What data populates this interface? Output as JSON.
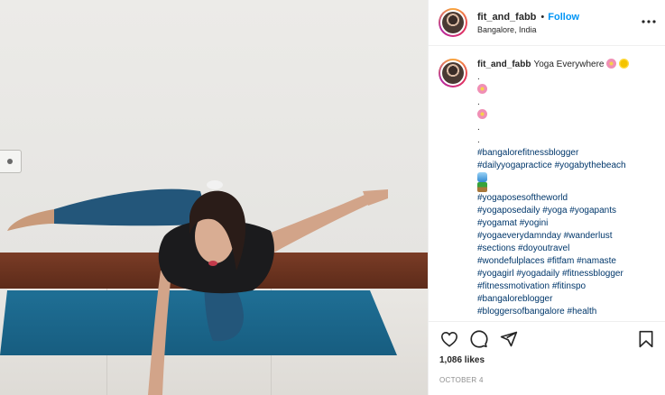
{
  "post": {
    "username": "fit_and_fabb",
    "location": "Bangalore, India",
    "follow_label": "Follow",
    "separator": "•",
    "more_icon": "more-horizontal-icon",
    "caption": {
      "username": "fit_and_fabb",
      "text": "Yoga Everywhere",
      "filler_lines": [
        "."
      ],
      "hashtag_lines": [
        "#bangalorefitnessblogger",
        "#dailyyogapractice #yogabythebeach",
        "#yogaposesoftheworld",
        "#yogaposedaily #yoga #yogapants",
        "#yogamat #yogini",
        "#yogaeverydamnday #wanderlust",
        "#sections #doyoutravel",
        "#wondefulplaces #fitfam #namaste",
        "#yogagirl #yogadaily #fitnessblogger",
        "#fitnessmotivation #fitinspo",
        "#bangaloreblogger",
        "#bloggersofbangalore #health"
      ]
    },
    "actions": {
      "like_icon": "heart-icon",
      "comment_icon": "comment-icon",
      "share_icon": "share-icon",
      "save_icon": "bookmark-icon"
    },
    "likes_text": "1,086 likes",
    "date_text": "OCTOBER 4",
    "colors": {
      "follow": "#0095f6",
      "hashtag": "#00376b",
      "text": "#262626",
      "muted": "#8e8e8e",
      "mat": "#1f6f95"
    }
  }
}
